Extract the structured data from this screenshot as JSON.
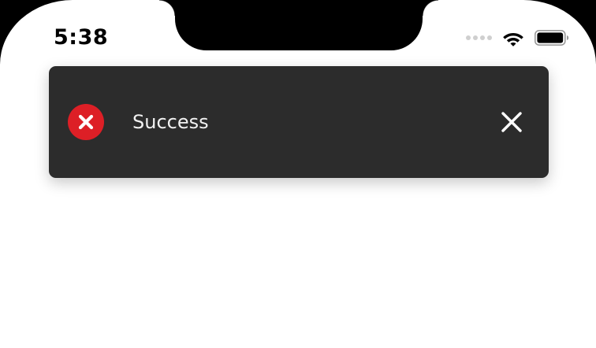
{
  "status_bar": {
    "time": "5:38",
    "icons": [
      "cellular-signal-icon",
      "wifi-icon",
      "battery-icon"
    ]
  },
  "toast": {
    "message": "Success",
    "status_icon": "error-icon",
    "close_icon": "close-icon"
  },
  "colors": {
    "toast_background": "#2c2c2c",
    "error_red": "#dd1f26",
    "screen_background": "#ffffff",
    "frame": "#000000"
  }
}
